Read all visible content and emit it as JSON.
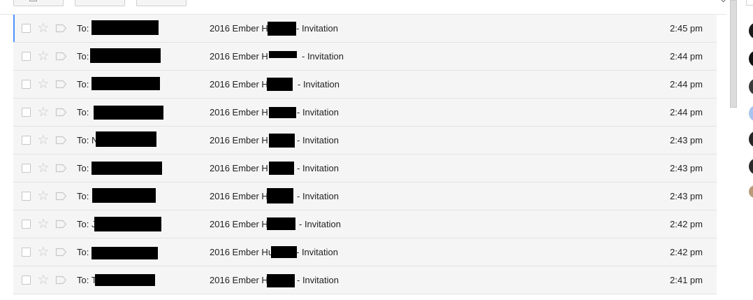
{
  "messages": [
    {
      "to": "To:",
      "subject_prefix": "2016 Ember H",
      "subject_suffix": "- Invitation",
      "time": "2:45 pm"
    },
    {
      "to": "To:",
      "subject_prefix": "2016 Ember H",
      "subject_suffix": "- Invitation",
      "time": "2:44 pm"
    },
    {
      "to": "To:",
      "subject_prefix": "2016 Ember H",
      "subject_suffix": "- Invitation",
      "time": "2:44 pm"
    },
    {
      "to": "To:",
      "subject_prefix": "2016 Ember H",
      "subject_suffix": "- Invitation",
      "time": "2:44 pm"
    },
    {
      "to": "To: N",
      "subject_prefix": "2016 Ember H",
      "subject_suffix": "- Invitation",
      "time": "2:43 pm"
    },
    {
      "to": "To:",
      "subject_prefix": "2016 Ember H",
      "subject_suffix": "- Invitation",
      "time": "2:43 pm"
    },
    {
      "to": "To:",
      "subject_prefix": "2016 Ember H",
      "subject_suffix": "- Invitation",
      "time": "2:43 pm"
    },
    {
      "to": "To: J",
      "subject_prefix": "2016 Ember H",
      "subject_suffix": "- Invitation",
      "time": "2:42 pm"
    },
    {
      "to": "To:",
      "subject_prefix": "2016 Ember Hu",
      "subject_suffix": "- Invitation",
      "time": "2:42 pm"
    },
    {
      "to": "To: T",
      "subject_prefix": "2016 Ember H",
      "subject_suffix": "- Invitation",
      "time": "2:41 pm"
    }
  ],
  "colors": {
    "row_bg": "#f5f5f5",
    "focus_bar": "#4d90fe",
    "redaction": "#000000",
    "text": "#222222"
  },
  "icons": {
    "checkbox": "checkbox-icon",
    "star": "star-icon",
    "label": "label-icon",
    "refresh": "refresh-icon",
    "chevron": "chevron-icon"
  }
}
